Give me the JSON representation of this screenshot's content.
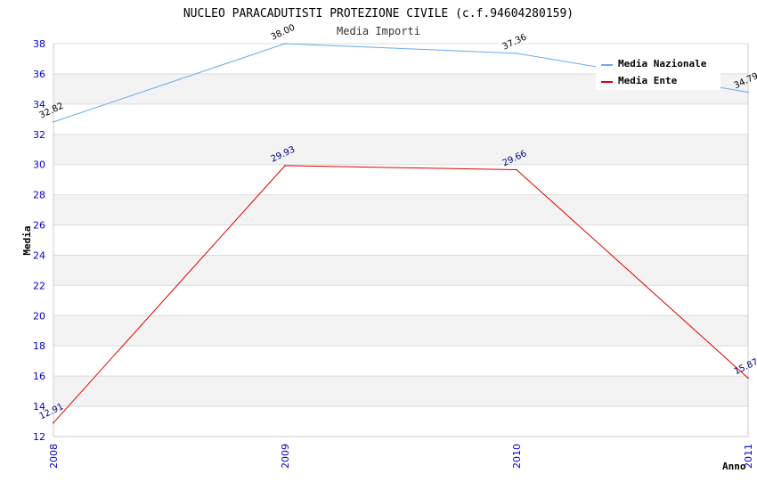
{
  "chart_data": {
    "type": "line",
    "title": "NUCLEO PARACADUTISTI PROTEZIONE CIVILE (c.f.94604280159)",
    "subtitle": "Media Importi",
    "xlabel": "Anno",
    "ylabel": "Media",
    "categories": [
      "2008",
      "2009",
      "2010",
      "2011"
    ],
    "ylim": [
      12,
      38
    ],
    "yticks": [
      12,
      14,
      16,
      18,
      20,
      22,
      24,
      26,
      28,
      30,
      32,
      34,
      36,
      38
    ],
    "grid": true,
    "legend_position": "top-right",
    "series": [
      {
        "name": "Media Nazionale",
        "color": "#66aaee",
        "label_color": "#000000",
        "values": [
          32.82,
          38.0,
          37.36,
          34.79
        ],
        "labels": [
          "32.82",
          "38.00",
          "37.36",
          "34.79"
        ]
      },
      {
        "name": "Media Ente",
        "color": "#dd0000",
        "label_color": "#000080",
        "values": [
          12.91,
          29.93,
          29.66,
          15.87
        ],
        "labels": [
          "12.91",
          "29.93",
          "29.66",
          "15.87"
        ]
      }
    ]
  }
}
